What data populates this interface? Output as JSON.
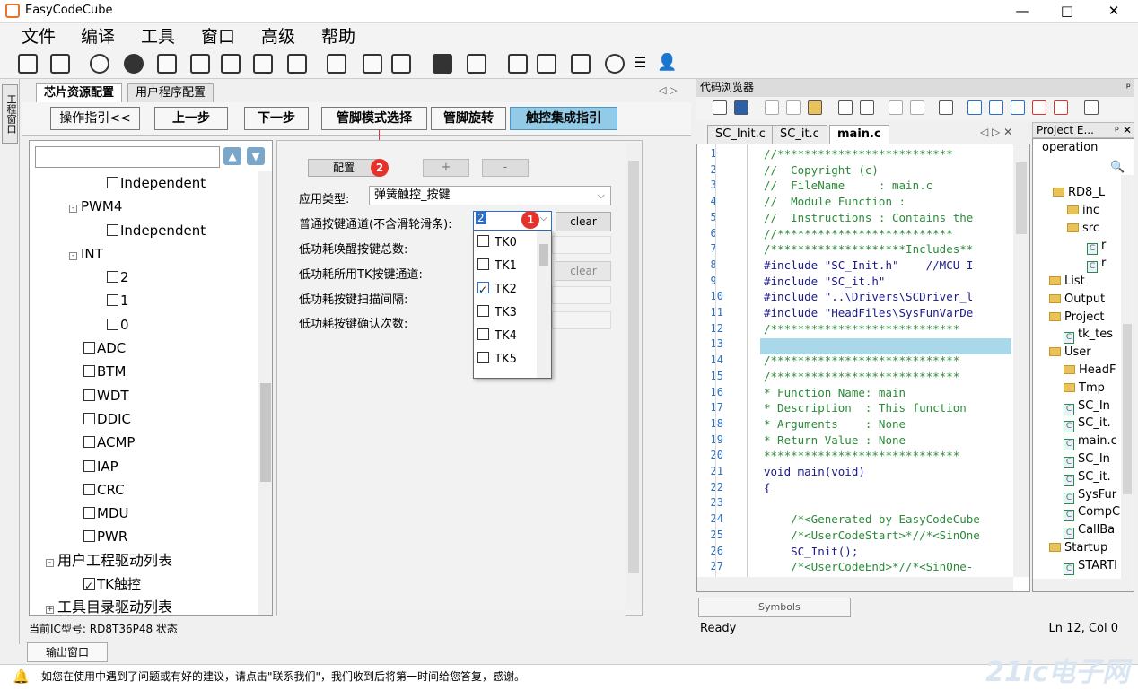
{
  "window": {
    "title": "EasyCodeCube",
    "minimize": "—",
    "maximize": "□",
    "close": "✕"
  },
  "menu": [
    "文件",
    "编译",
    "工具",
    "窗口",
    "高级",
    "帮助"
  ],
  "sidebar": {
    "vertical_tab": "工程窗口"
  },
  "left_tabs": [
    "芯片资源配置",
    "用户程序配置"
  ],
  "steps": {
    "guide": "操作指引<<",
    "prev": "上一步",
    "next": "下一步",
    "pin_mode": "管脚模式选择",
    "pin_rotate": "管脚旋转",
    "touch_guide": "触控集成指引"
  },
  "tree": {
    "nodes": [
      {
        "label": "Independent",
        "check": false
      },
      {
        "label": "PWM4"
      },
      {
        "label": "Independent",
        "check": false
      },
      {
        "label": "INT"
      },
      {
        "label": "2",
        "check": false
      },
      {
        "label": "1",
        "check": false
      },
      {
        "label": "0",
        "check": false
      },
      {
        "label": "ADC",
        "check": false
      },
      {
        "label": "BTM",
        "check": false
      },
      {
        "label": "WDT",
        "check": false
      },
      {
        "label": "DDIC",
        "check": false
      },
      {
        "label": "ACMP",
        "check": false
      },
      {
        "label": "IAP",
        "check": false
      },
      {
        "label": "CRC",
        "check": false
      },
      {
        "label": "MDU",
        "check": false
      },
      {
        "label": "PWR",
        "check": false
      },
      {
        "label": "用户工程驱动列表"
      },
      {
        "label": "TK触控",
        "check": true
      },
      {
        "label": "工具目录驱动列表"
      }
    ]
  },
  "config": {
    "cfg_button": "配置",
    "plus": "+",
    "minus": "-",
    "badge1": "1",
    "badge2": "2",
    "app_type_label": "应用类型:",
    "app_type_value": "弹簧触控_按键",
    "channel_label": "普通按键通道(不含滑轮滑条):",
    "channel_value": "2",
    "clear": "clear",
    "lp_wake_total_label": "低功耗唤醒按键总数:",
    "lp_tk_channel_label": "低功耗所用TK按键通道:",
    "lp_scan_interval_label": "低功耗按键扫描间隔:",
    "lp_confirm_label": "低功耗按键确认次数:",
    "dropdown": [
      {
        "label": "TK0",
        "checked": false
      },
      {
        "label": "TK1",
        "checked": false
      },
      {
        "label": "TK2",
        "checked": true
      },
      {
        "label": "TK3",
        "checked": false
      },
      {
        "label": "TK4",
        "checked": false
      },
      {
        "label": "TK5",
        "checked": false
      }
    ]
  },
  "status_left": "当前IC型号:    RD8T36P48  状态",
  "output_tab": "输出窗口",
  "footer": "如您在使用中遇到了问题或有好的建议，请点击\"联系我们\"，我们收到后将第一时间给您答复，感谢。",
  "watermark": "21ic电子网",
  "code_browser": {
    "title": "代码浏览器",
    "pin": "ᵖ"
  },
  "editor_tabs": [
    "SC_Init.c",
    "SC_it.c",
    "main.c"
  ],
  "code_lines": [
    "//**************************",
    "//  Copyright (c)",
    "//  FileName     : main.c",
    "//  Module Function :",
    "//  Instructions : Contains the",
    "//**************************",
    "/********************Includes**",
    "#include \"SC_Init.h\"    //MCU I",
    "#include \"SC_it.h\"",
    "#include \"..\\Drivers\\SCDriver_l",
    "#include \"HeadFiles\\SysFunVarDe",
    "/****************************",
    "",
    "/****************************",
    "/****************************",
    "* Function Name: main",
    "* Description  : This function",
    "* Arguments    : None",
    "* Return Value : None",
    "*****************************",
    "void main(void)",
    "{",
    "",
    "    /*<Generated by EasyCodeCube",
    "    /*<UserCodeStart>*//*<SinOne",
    "    SC_Init();",
    "    /*<UserCodeEnd>*//*<SinOne-"
  ],
  "symbols_tab": "Symbols",
  "status_right": {
    "ready": "Ready",
    "pos": "Ln 12, Col 0"
  },
  "project": {
    "title": "Project E...",
    "search": "operation",
    "items": [
      "RD8_L",
      "inc",
      "src",
      "r",
      "r",
      "List",
      "Output",
      "Project",
      "tk_tes",
      "User",
      "HeadF",
      "Tmp",
      "SC_In",
      "SC_it.",
      "main.c",
      "SC_In",
      "SC_it.",
      "SysFur",
      "CompC",
      "CallBa",
      "Startup",
      "STARTI"
    ]
  }
}
